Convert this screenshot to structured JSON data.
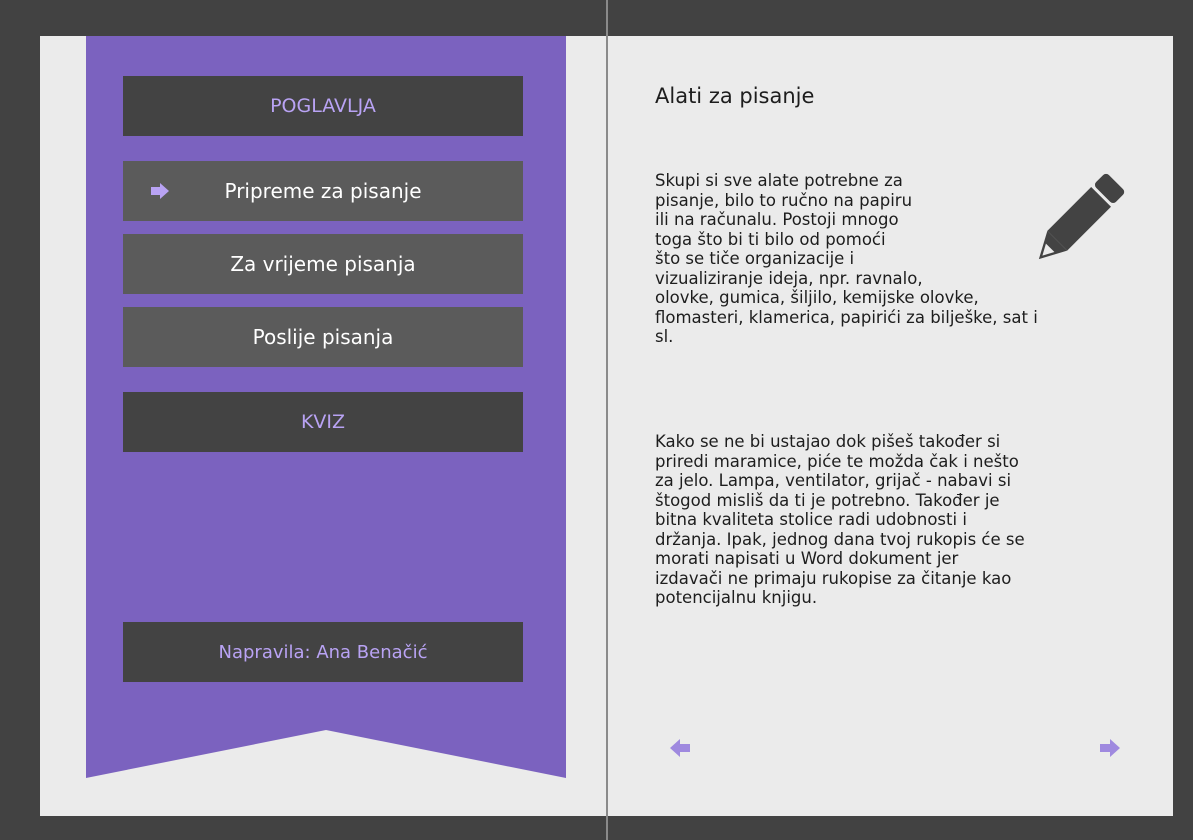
{
  "sidebar": {
    "header": "POGLAVLJA",
    "items": [
      {
        "label": "Pripreme za pisanje",
        "active": true,
        "icon": "arrow-right-icon"
      },
      {
        "label": "Za vrijeme pisanja",
        "active": false
      },
      {
        "label": "Poslije pisanja",
        "active": false
      }
    ],
    "quiz": "KVIZ",
    "author": "Napravila: Ana Benačić"
  },
  "content": {
    "title": "Alati za pisanje",
    "paragraph1": [
      "Skupi si sve alate potrebne za",
      "pisanje, bilo to ručno na papiru",
      "ili na računalu. Postoji mnogo",
      "toga što bi ti bilo od pomoći",
      "što se tiče organizacije i",
      "vizualiziranje ideja, npr. ravnalo,",
      "olovke, gumica, šiljilo, kemijske olovke,",
      "flomasteri, klamerica, papirići za bilješke, sat i",
      "sl."
    ],
    "paragraph2": [
      "Kako se ne bi ustajao dok pišeš također si",
      "priredi maramice, piće te možda čak i nešto",
      "za jelo. Lampa, ventilator, grijač - nabavi si",
      "štogod misliš da ti je potrebno. Također je",
      "bitna kvaliteta stolice radi udobnosti i",
      "držanja. Ipak, jednog dana tvoj rukopis će se",
      "morati napisati u Word dokument jer",
      "izdavači ne primaju rukopise za čitanje kao",
      "potencijalnu knjigu."
    ],
    "illustration_icon": "pencil-icon"
  },
  "navigation": {
    "prev_icon": "arrow-left-icon",
    "next_icon": "arrow-right-icon"
  },
  "colors": {
    "accent": "#7b62bf",
    "accent_text": "#b9a3f4",
    "dark_box": "#434343",
    "gray_box": "#5b5b5b",
    "page": "#ebebeb",
    "frame": "#424242"
  }
}
